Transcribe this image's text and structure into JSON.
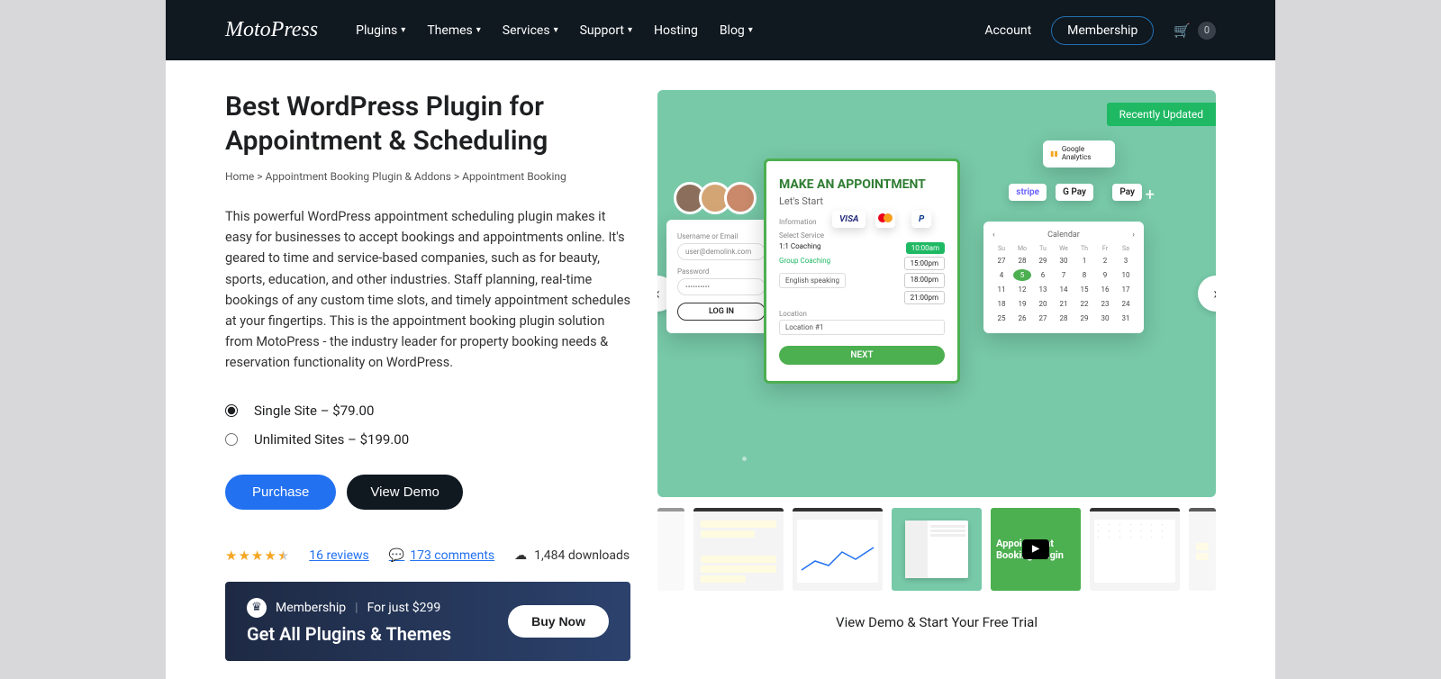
{
  "header": {
    "logo": "MotoPress",
    "nav": [
      "Plugins",
      "Themes",
      "Services",
      "Support",
      "Hosting",
      "Blog"
    ],
    "nav_dropdown": [
      true,
      true,
      true,
      true,
      false,
      true
    ],
    "account": "Account",
    "membership": "Membership",
    "cart_count": "0"
  },
  "page": {
    "title": "Best WordPress Plugin for Appointment & Scheduling",
    "breadcrumb": {
      "home": "Home",
      "cat": "Appointment Booking Plugin & Addons",
      "current": "Appointment Booking",
      "sep": ">"
    },
    "description": "This powerful WordPress appointment scheduling plugin makes it easy for businesses to accept bookings and appointments online. It's geared to time and service-based companies, such as for beauty, sports, education, and other industries. Staff planning, real-time bookings of any custom time slots, and timely appointment schedules at your fingertips. This is the appointment booking plugin solution from MotoPress - the industry leader for property booking needs & reservation functionality on WordPress."
  },
  "pricing": {
    "options": [
      {
        "label": "Single Site – $79.00",
        "selected": true
      },
      {
        "label": "Unlimited Sites – $199.00",
        "selected": false
      }
    ]
  },
  "buttons": {
    "purchase": "Purchase",
    "view_demo": "View Demo"
  },
  "stats": {
    "rating": 4.5,
    "reviews": "16 reviews",
    "comments": "173 comments",
    "downloads": "1,484 downloads"
  },
  "membership_banner": {
    "label": "Membership",
    "price": "For just $299",
    "title": "Get All Plugins & Themes",
    "buy": "Buy Now"
  },
  "hero": {
    "badge": "Recently Updated",
    "appoint_title": "MAKE AN APPOINTMENT",
    "appoint_sub": "Let's Start",
    "login_user_lbl": "Username or Email",
    "login_user_val": "user@demolink.com",
    "login_pass_lbl": "Password",
    "login_pass_val": "••••••••••",
    "login_btn": "LOG IN",
    "info_lbl": "Information",
    "sel_service": "Select Service",
    "svc1": "1:1 Coaching",
    "t1": "10:00am",
    "svc2": "Group Coaching",
    "t2": "15:00pm",
    "svc3": "English speaking",
    "t3": "18:00pm",
    "t4": "21:00pm",
    "loc_lbl": "Location",
    "loc_val": "Location #1",
    "next": "NEXT",
    "cal_title": "Calendar",
    "dow": [
      "Su",
      "Mo",
      "Tu",
      "We",
      "Th",
      "Fr",
      "Sa"
    ],
    "days": [
      "27",
      "28",
      "29",
      "30",
      "1",
      "2",
      "3",
      "4",
      "5",
      "6",
      "7",
      "8",
      "9",
      "10",
      "11",
      "12",
      "13",
      "14",
      "15",
      "16",
      "17",
      "18",
      "19",
      "20",
      "21",
      "22",
      "23",
      "24",
      "25",
      "26",
      "27",
      "28",
      "29",
      "30",
      "31"
    ],
    "active_day_idx": 8,
    "ga": "Google Analytics",
    "stripe": "stripe",
    "gpay": "G Pay",
    "apay": "Pay",
    "visa": "VISA"
  },
  "demo_link": "View Demo & Start Your Free Trial",
  "thumbs": {
    "video_text": "Appointment Booking Plugin"
  }
}
